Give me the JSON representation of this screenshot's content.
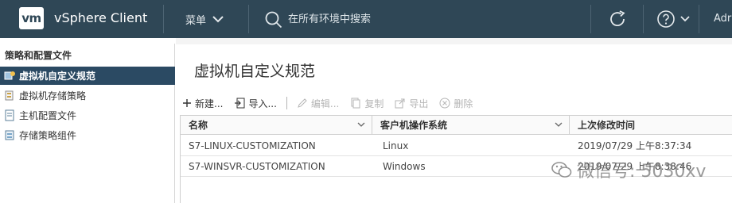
{
  "header": {
    "logo": "vm",
    "app_title": "vSphere Client",
    "menu_label": "菜单",
    "search_placeholder": "在所有环境中搜索",
    "user_label": "Adr"
  },
  "sidebar": {
    "title": "策略和配置文件",
    "items": [
      {
        "label": "虚拟机自定义规范",
        "icon": "customization-spec-icon",
        "active": true
      },
      {
        "label": "虚拟机存储策略",
        "icon": "storage-policy-icon",
        "active": false
      },
      {
        "label": "主机配置文件",
        "icon": "host-profile-icon",
        "active": false
      },
      {
        "label": "存储策略组件",
        "icon": "policy-component-icon",
        "active": false
      }
    ]
  },
  "main": {
    "title": "虚拟机自定义规范",
    "toolbar": {
      "new": "新建...",
      "import": "导入...",
      "edit": "编辑...",
      "copy": "复制",
      "export": "导出",
      "delete": "删除"
    },
    "grid": {
      "columns": [
        "名称",
        "客户机操作系统",
        "上次修改时间"
      ],
      "rows": [
        [
          "S7-LINUX-CUSTOMIZATION",
          "Linux",
          "2019/07/29 上午8:37:34"
        ],
        [
          "S7-WINSVR-CUSTOMIZATION",
          "Windows",
          "2019/07/29 上午8:38:46"
        ]
      ]
    }
  },
  "watermark": "微信号: 5030xv",
  "colors": {
    "header_bg": "#2f4756",
    "sidebar_active_bg": "#2b4a63",
    "disabled_text": "#b5b5b5"
  }
}
